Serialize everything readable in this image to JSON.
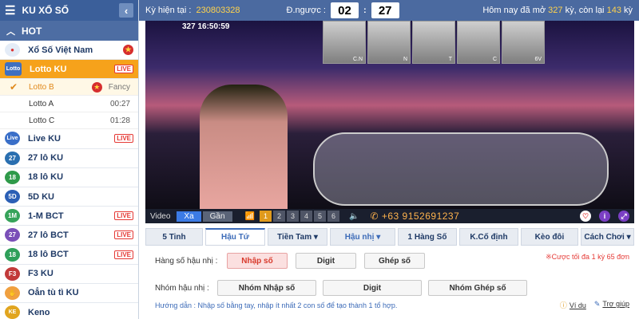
{
  "sidebar": {
    "title": "KU XỔ SỐ",
    "hot_label": "HOT",
    "items": [
      {
        "label": "Xổ Số Việt Nam",
        "icon": "lottery-balls-icon",
        "badge": "star"
      },
      {
        "label": "Lotto KU",
        "icon": "lotto-icon",
        "icon_text": "Lotto",
        "badge": "LIVE",
        "active": true
      },
      {
        "label": "Live KU",
        "icon": "live-icon",
        "icon_text": "Live",
        "badge": "LIVE"
      },
      {
        "label": "27 lô KU",
        "icon": "27-icon",
        "icon_text": "27"
      },
      {
        "label": "18 lô KU",
        "icon": "18-icon",
        "icon_text": "18"
      },
      {
        "label": "5D KU",
        "icon": "5d-icon",
        "icon_text": "5D"
      },
      {
        "label": "1-M BCT",
        "icon": "1m-icon",
        "icon_text": "1M",
        "badge": "LIVE"
      },
      {
        "label": "27 lô BCT",
        "icon": "27-icon",
        "icon_text": "27",
        "badge": "LIVE"
      },
      {
        "label": "18 lô BCT",
        "icon": "18-icon",
        "icon_text": "18",
        "badge": "LIVE"
      },
      {
        "label": "F3 KU",
        "icon": "f3-icon",
        "icon_text": "F3"
      },
      {
        "label": "Oẳn tù tì KU",
        "icon": "hand-icon",
        "icon_text": "✋"
      },
      {
        "label": "Keno",
        "icon": "keno-icon",
        "icon_text": "KE"
      }
    ],
    "subitems": [
      {
        "label": "Lotto B",
        "extra": "Fancy",
        "selected": true
      },
      {
        "label": "Lotto A",
        "time": "00:27"
      },
      {
        "label": "Lotto C",
        "time": "01:28"
      }
    ],
    "live_badge": "LIVE",
    "fancy_label": "Fancy"
  },
  "topbar": {
    "period_label": "Kỳ hiện tại :",
    "period_value": "230803328",
    "countdown_label": "Đ.ngược :",
    "countdown_min": "02",
    "countdown_sec": "27",
    "today_prefix": "Hôm nay đã mở",
    "opened": "327",
    "today_mid": "kỳ, còn lại",
    "remaining": "143",
    "today_suffix": "kỳ"
  },
  "video": {
    "overlay_time": "327  16:50:59",
    "drum_labels": [
      "C.N",
      "N",
      "T",
      "C",
      "6V"
    ],
    "label": "Video",
    "btn_far": "Xa",
    "btn_near": "Gần",
    "quality": [
      "1",
      "2",
      "3",
      "4",
      "5",
      "6"
    ],
    "phone": "+63 9152691237"
  },
  "tabs": [
    "5 Tinh",
    "Hậu Tứ",
    "Tiền Tam ▾",
    "Hậu nhị ▾",
    "1 Hàng Số",
    "K.Cố định",
    "Kèo đôi",
    "Cách Chơi ▾"
  ],
  "bet": {
    "row1_label": "Hàng số hậu nhị :",
    "row1_btns": [
      "Nhập số",
      "Digit",
      "Ghép số"
    ],
    "row2_label": "Nhóm hậu nhị :",
    "row2_btns": [
      "Nhóm Nhập số",
      "Digit",
      "Nhóm Ghép số"
    ],
    "note": "※Cược tối đa 1 kỳ 65 đơn",
    "guide": "Hướng dẫn : Nhập số bằng tay, nhập ít nhất 2 con số để tạo thành 1 tổ hợp.",
    "example": "Ví dụ",
    "help": "Trợ giúp"
  },
  "colors": {
    "accent": "#f6a21b",
    "header": "#4b6aa0",
    "live": "#e53935"
  }
}
